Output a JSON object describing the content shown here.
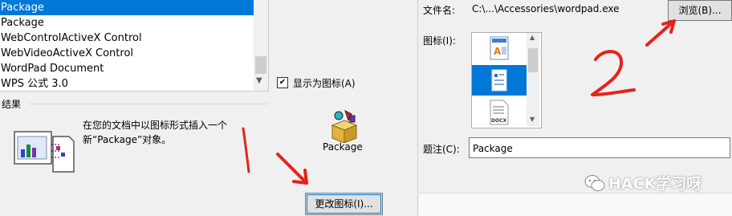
{
  "object_list": {
    "items": [
      "Package",
      "Package",
      "WebControlActiveX Control",
      "WebVideoActiveX Control",
      "WordPad Document",
      "WPS 公式 3.0"
    ],
    "selected_index": 0
  },
  "display_as_icon": {
    "label": "显示为图标(A)",
    "checked": true
  },
  "result": {
    "label": "结果",
    "text": "在您的文档中以图标形式插入一个新“Package”对象。"
  },
  "package_icon": {
    "label": "Package"
  },
  "change_icon_button": {
    "label": "更改图标(I)..."
  },
  "change_icon_dialog": {
    "file_label": "文件名:",
    "file_value": "C:\\...\\Accessories\\wordpad.exe",
    "browse_label": "浏览(B)...",
    "icon_label": "图标(I):",
    "icons": [
      "wordpad-doc-icon",
      "wordpad-selected-icon",
      "docx-icon"
    ],
    "selected_icon_index": 1,
    "caption_label": "题注(C):",
    "caption_value": "Package"
  },
  "annotations": {
    "number_1": "1",
    "number_2": "2",
    "color": "#e5231b"
  },
  "watermark": {
    "text": "HACK学习呀"
  }
}
